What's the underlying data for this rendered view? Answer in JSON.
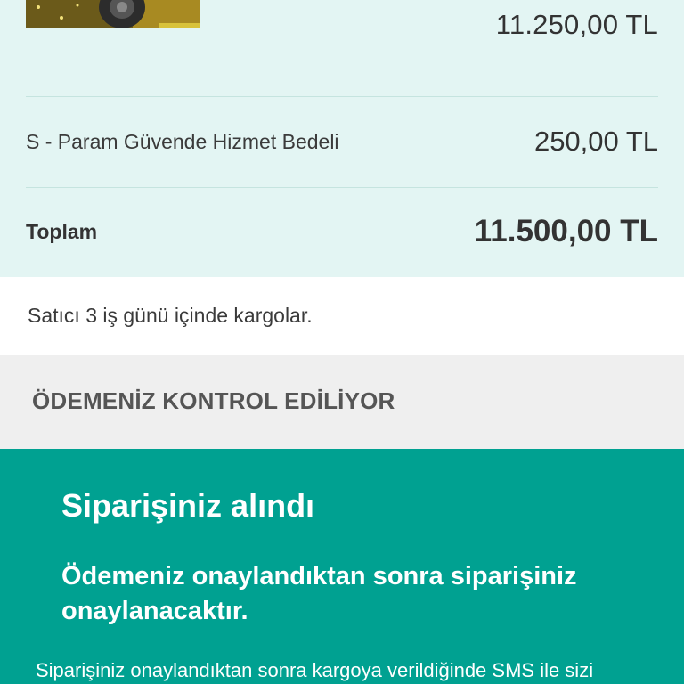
{
  "order_summary": {
    "product_price": "11.250,00 TL",
    "fee_label": "S - Param Güvende Hizmet Bedeli",
    "fee_value": "250,00 TL",
    "total_label": "Toplam",
    "total_value": "11.500,00 TL"
  },
  "shipping": {
    "text": "Satıcı 3 iş günü içinde kargolar."
  },
  "payment_status": {
    "text": "ÖDEMENİZ KONTROL EDİLİYOR"
  },
  "confirmation": {
    "title": "Siparişiniz alındı",
    "subtitle": "Ödemeniz onaylandıktan sonra siparişiniz onaylanacaktır.",
    "body": "Siparişiniz onaylandıktan sonra kargoya verildiğinde SMS ile sizi"
  },
  "colors": {
    "summary_bg": "#e3f5f3",
    "status_bg": "#efefef",
    "confirm_bg": "#00a191"
  },
  "icons": {
    "product_image": "product-thumbnail"
  }
}
